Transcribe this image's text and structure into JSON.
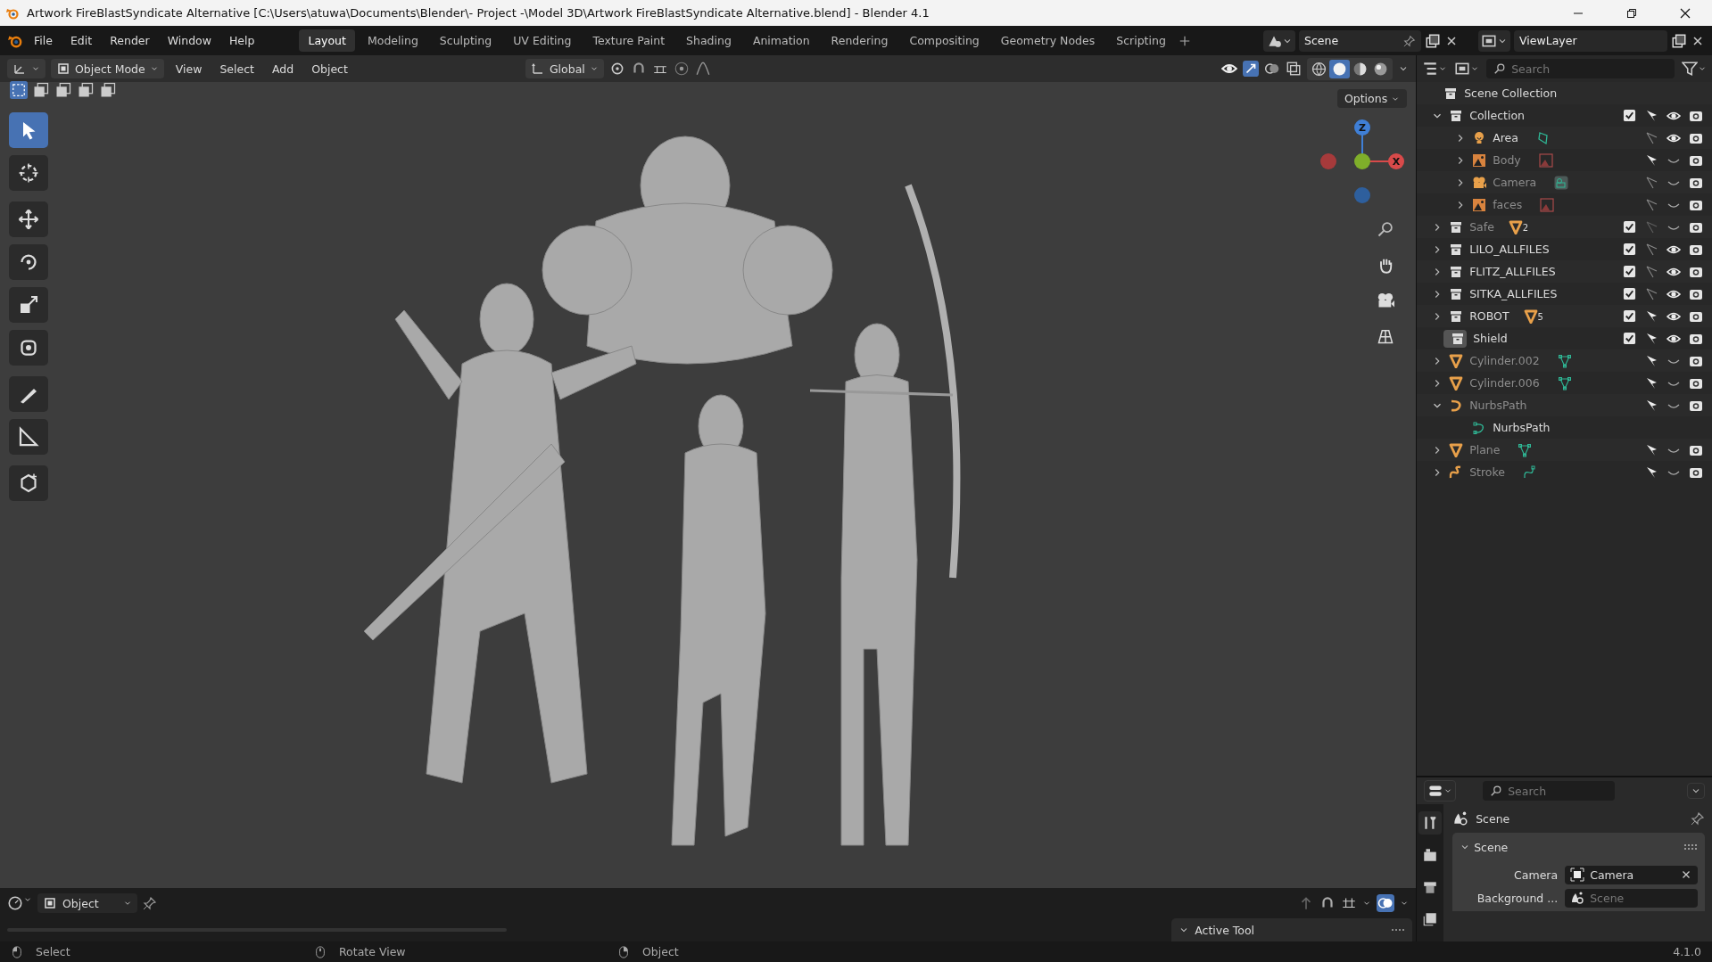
{
  "window": {
    "title": "Artwork FireBlastSyndicate Alternative [C:\\Users\\atuwa\\Documents\\Blender\\- Project -\\Model 3D\\Artwork FireBlastSyndicate Alternative.blend] - Blender 4.1"
  },
  "menu": [
    "File",
    "Edit",
    "Render",
    "Window",
    "Help"
  ],
  "workspaces": [
    {
      "label": "Layout",
      "selected": true
    },
    {
      "label": "Modeling",
      "selected": false
    },
    {
      "label": "Sculpting",
      "selected": false
    },
    {
      "label": "UV Editing",
      "selected": false
    },
    {
      "label": "Texture Paint",
      "selected": false
    },
    {
      "label": "Shading",
      "selected": false
    },
    {
      "label": "Animation",
      "selected": false
    },
    {
      "label": "Rendering",
      "selected": false
    },
    {
      "label": "Compositing",
      "selected": false
    },
    {
      "label": "Geometry Nodes",
      "selected": false
    },
    {
      "label": "Scripting",
      "selected": false
    }
  ],
  "scene_field": {
    "value": "Scene"
  },
  "view_layer_field": {
    "value": "ViewLayer"
  },
  "viewport_header": {
    "mode": "Object Mode",
    "menus": [
      "View",
      "Select",
      "Add",
      "Object"
    ],
    "orientation": "Global",
    "shading": [
      {
        "selected": false
      },
      {
        "selected": true
      },
      {
        "selected": false
      },
      {
        "selected": false
      }
    ]
  },
  "viewport": {
    "options": "Options",
    "axes": [
      "Z",
      "X"
    ]
  },
  "outliner": {
    "search_placeholder": "Search",
    "root": "Scene Collection",
    "items": [
      {
        "name": "Collection",
        "kind": "collection",
        "expanded": true,
        "empty": false,
        "checked": true,
        "selectable": true,
        "visible": true,
        "dimmed": false,
        "children": [
          {
            "name": "Area",
            "kind": "light",
            "expanded": false,
            "empty": false,
            "selectable": false,
            "visible": true,
            "dimmed": false
          },
          {
            "name": "Body",
            "kind": "image",
            "expanded": false,
            "empty": false,
            "selectable": true,
            "visible": false,
            "dimmed": true
          },
          {
            "name": "Camera",
            "kind": "camera",
            "expanded": false,
            "empty": false,
            "selectable": false,
            "visible": false,
            "dimmed": true
          },
          {
            "name": "faces",
            "kind": "image",
            "expanded": false,
            "empty": false,
            "selectable": false,
            "visible": false,
            "dimmed": true
          }
        ]
      },
      {
        "name": "Safe",
        "kind": "collection",
        "expanded": false,
        "empty": false,
        "checked": true,
        "selectable": false,
        "visible": false,
        "dimmed": true,
        "badge": "2"
      },
      {
        "name": "LILO_ALLFILES",
        "kind": "collection",
        "expanded": false,
        "empty": false,
        "checked": true,
        "selectable": false,
        "visible": true,
        "dimmed": false
      },
      {
        "name": "FLITZ_ALLFILES",
        "kind": "collection",
        "expanded": false,
        "empty": false,
        "checked": true,
        "selectable": false,
        "visible": true,
        "dimmed": false
      },
      {
        "name": "SITKA_ALLFILES",
        "kind": "collection",
        "expanded": false,
        "empty": false,
        "checked": true,
        "selectable": false,
        "visible": true,
        "dimmed": false
      },
      {
        "name": "ROBOT",
        "kind": "collection",
        "expanded": false,
        "empty": false,
        "checked": true,
        "selectable": true,
        "visible": true,
        "dimmed": false,
        "badge": "5"
      },
      {
        "name": "Shield",
        "kind": "collection",
        "expanded": false,
        "empty": true,
        "checked": true,
        "selectable": true,
        "visible": true,
        "dimmed": false
      },
      {
        "name": "Cylinder.002",
        "kind": "mesh",
        "expanded": false,
        "empty": false,
        "selectable": true,
        "visible": false,
        "dimmed": true
      },
      {
        "name": "Cylinder.006",
        "kind": "mesh",
        "expanded": false,
        "empty": false,
        "selectable": true,
        "visible": false,
        "dimmed": true
      },
      {
        "name": "NurbsPath",
        "kind": "curve",
        "expanded": true,
        "empty": false,
        "selectable": true,
        "visible": false,
        "dimmed": true,
        "children": [
          {
            "name": "NurbsPath",
            "kind": "curvedata",
            "expanded": false,
            "empty": true,
            "dimmed": false
          }
        ]
      },
      {
        "name": "Plane",
        "kind": "mesh",
        "expanded": false,
        "empty": false,
        "selectable": true,
        "visible": false,
        "dimmed": true
      },
      {
        "name": "Stroke",
        "kind": "stroke",
        "expanded": false,
        "empty": false,
        "selectable": true,
        "visible": false,
        "dimmed": true
      }
    ]
  },
  "properties": {
    "search_placeholder": "Search",
    "context": "Scene",
    "panel": {
      "title": "Scene",
      "expanded": true,
      "fields": [
        {
          "label": "Camera",
          "value": "Camera"
        },
        {
          "label": "Background ...",
          "placeholder": "Scene"
        }
      ]
    }
  },
  "timeline_header": {
    "mode": "Object"
  },
  "active_tool_panel": {
    "title": "Active Tool",
    "expanded": true
  },
  "status_bar": {
    "hints": [
      "Select",
      "Rotate View",
      "Object"
    ],
    "version": "4.1.0"
  }
}
